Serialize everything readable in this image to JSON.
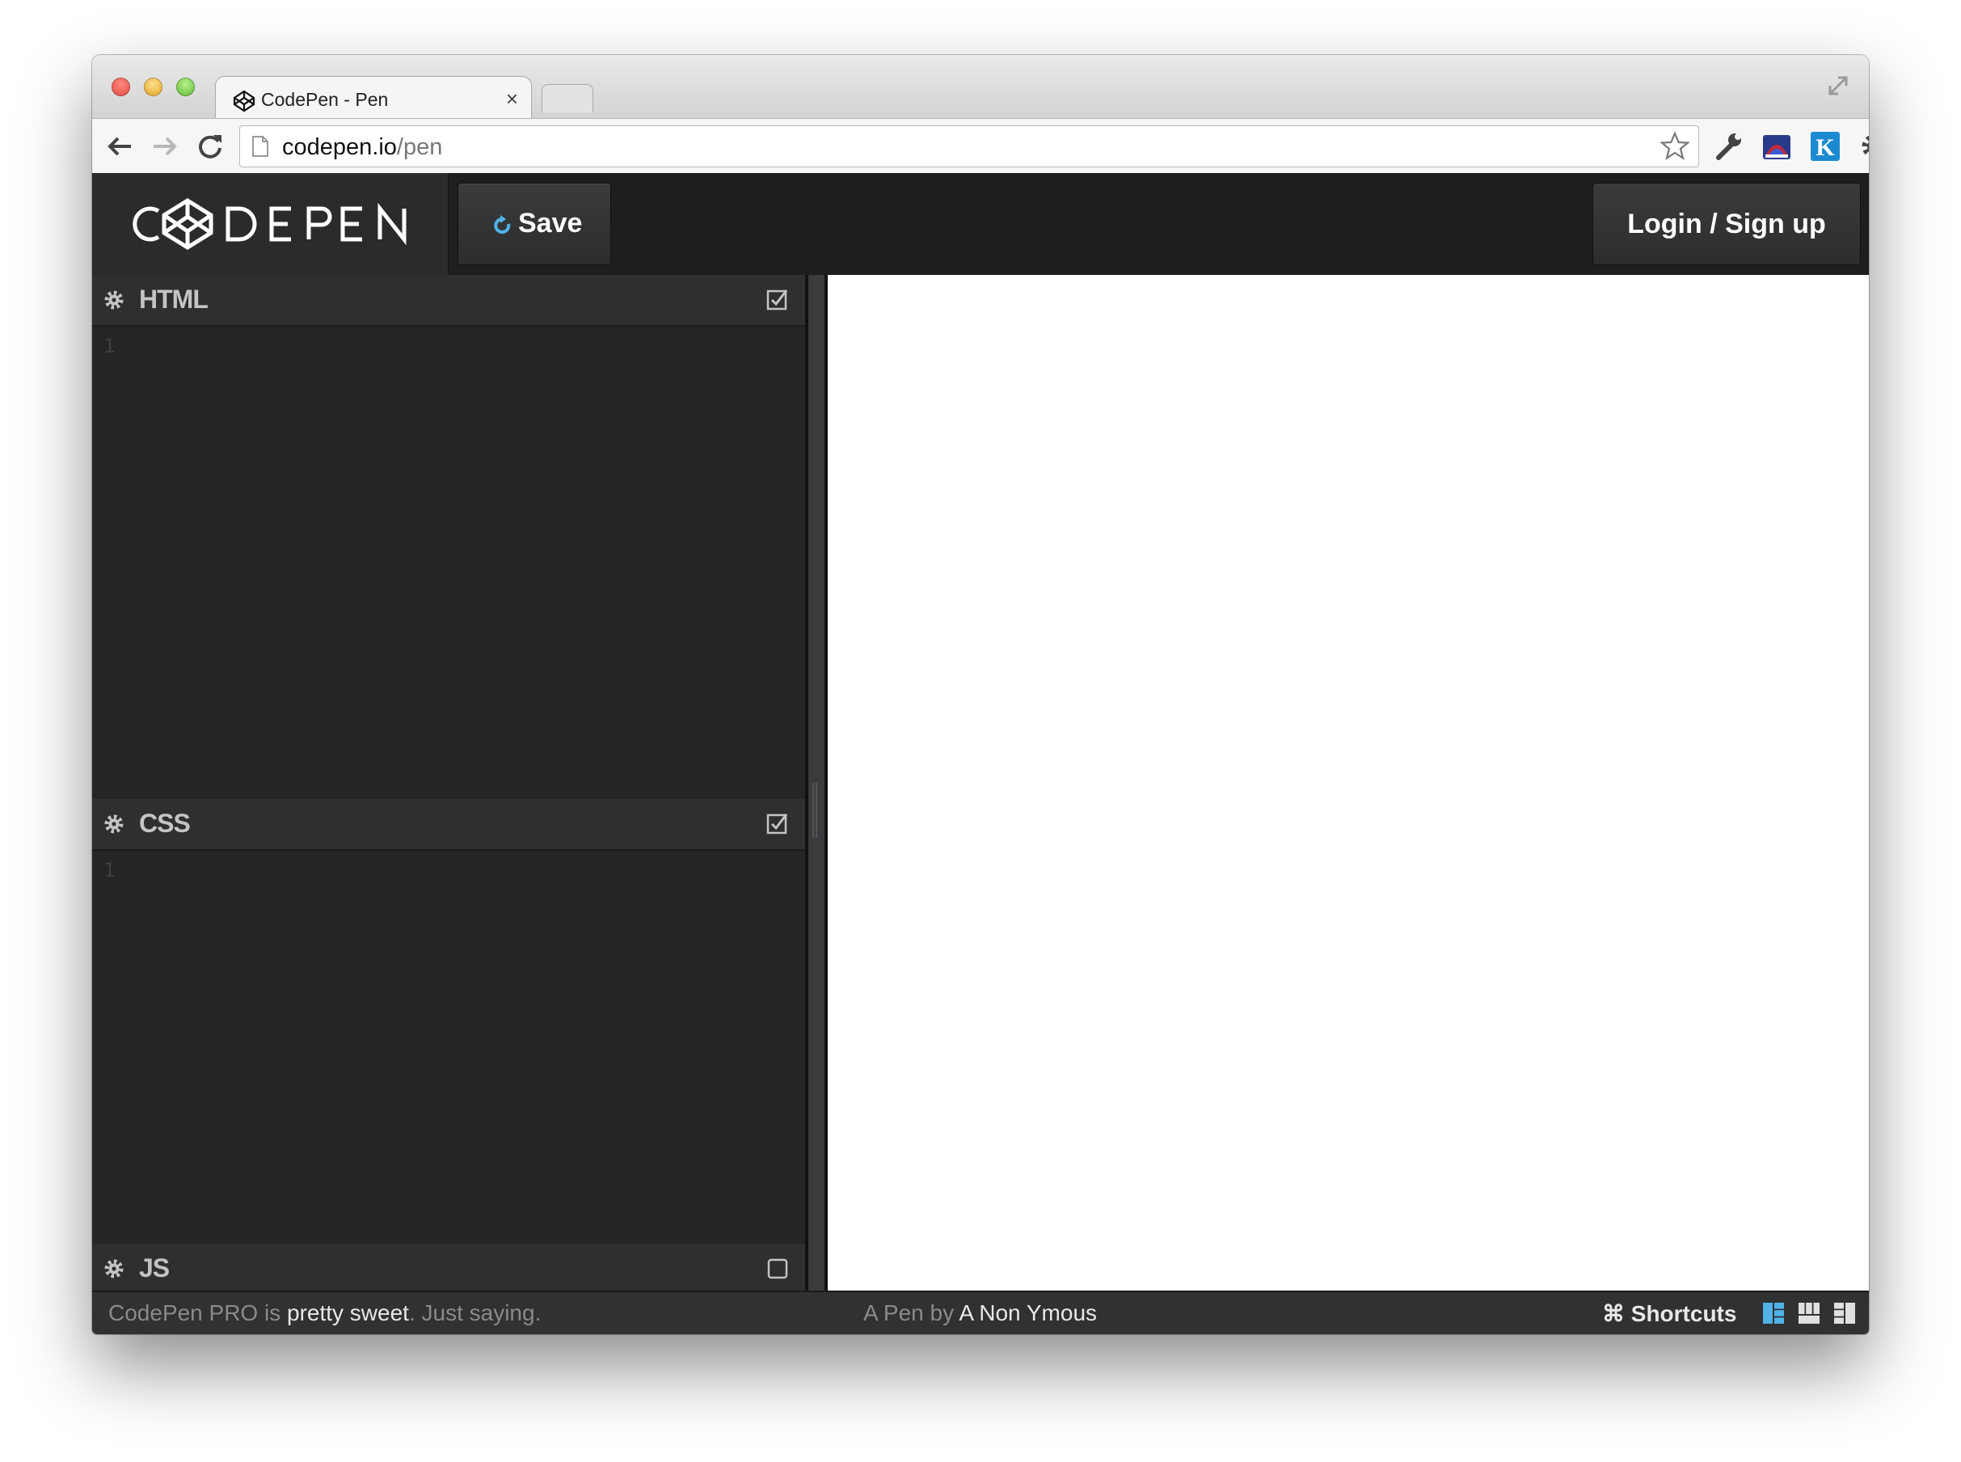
{
  "browser": {
    "tab_title": "CodePen - Pen",
    "tab_close": "×",
    "url_domain": "codepen.io",
    "url_path": "/pen"
  },
  "codepen": {
    "save_label": "Save",
    "login_label": "Login / Sign up",
    "panels": [
      {
        "title": "HTML",
        "line": "1",
        "checked": true
      },
      {
        "title": "CSS",
        "line": "1",
        "checked": true
      },
      {
        "title": "JS",
        "checked": false
      }
    ]
  },
  "footer": {
    "promo_prefix": "CodePen PRO is ",
    "promo_bold": "pretty sweet",
    "promo_suffix": ". Just saying.",
    "byline_prefix": "A Pen by ",
    "author": "A Non Ymous",
    "shortcuts_label": "⌘ Shortcuts"
  },
  "colors": {
    "header_bg": "#1d1e1f",
    "editor_bg": "#242527",
    "accent_refresh": "#4fb3e8"
  }
}
